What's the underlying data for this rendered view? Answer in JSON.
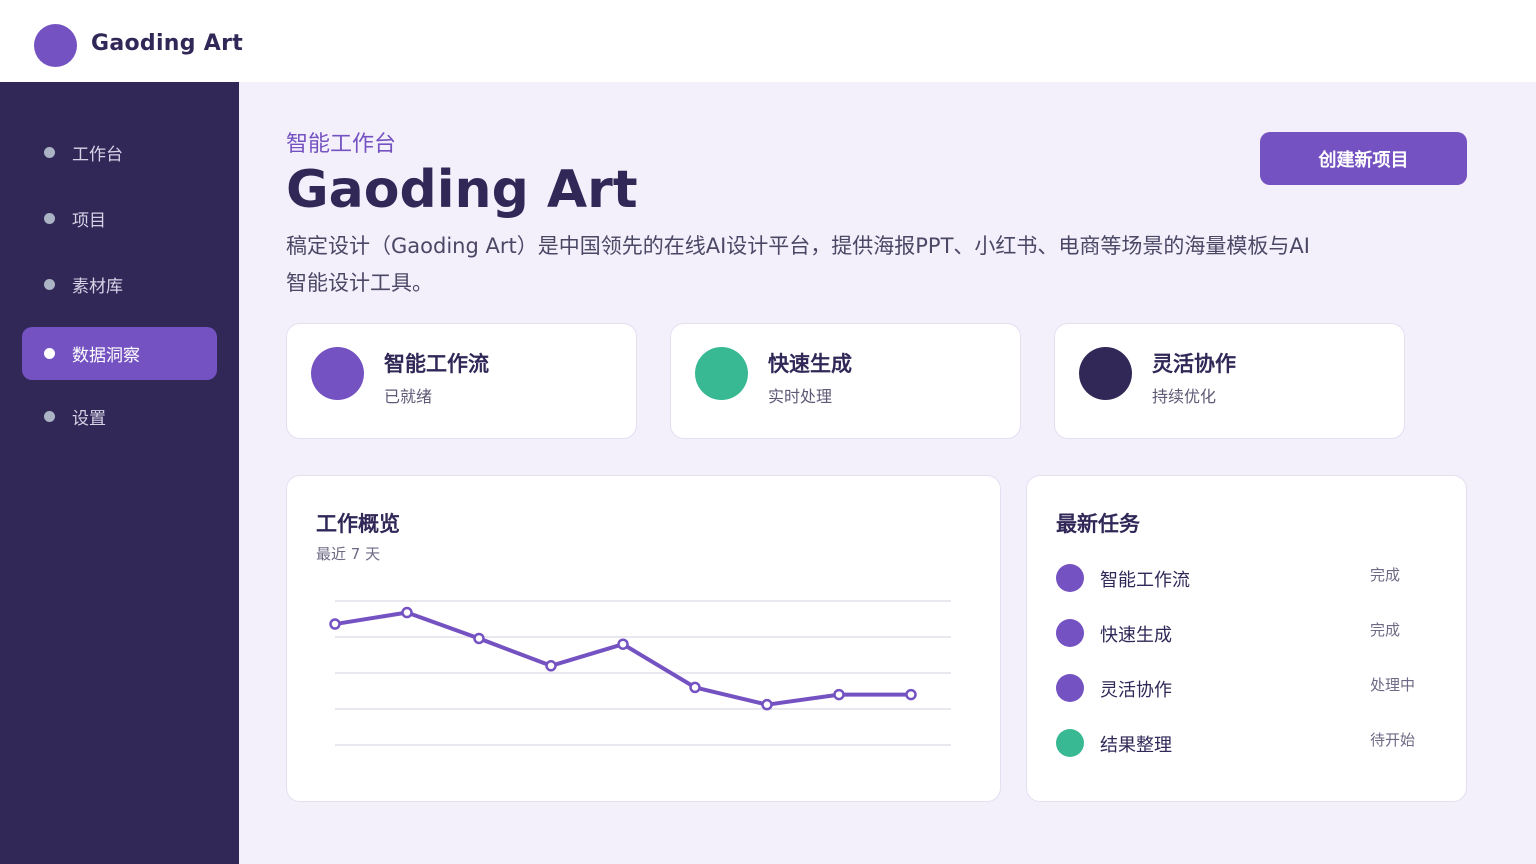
{
  "header": {
    "brand": "Gaoding Art"
  },
  "sidebar": {
    "items": [
      {
        "label": "工作台",
        "active": false
      },
      {
        "label": "项目",
        "active": false
      },
      {
        "label": "素材库",
        "active": false
      },
      {
        "label": "数据洞察",
        "active": true
      },
      {
        "label": "设置",
        "active": false
      }
    ]
  },
  "hero": {
    "eyebrow": "智能工作台",
    "title": "Gaoding Art",
    "description": "稿定设计（Gaoding Art）是中国领先的在线AI设计平台，提供海报PPT、小红书、电商等场景的海量模板与AI智能设计工具。",
    "cta_label": "创建新项目"
  },
  "stats": [
    {
      "title": "智能工作流",
      "subtitle": "已就绪",
      "color": "#7552c2"
    },
    {
      "title": "快速生成",
      "subtitle": "实时处理",
      "color": "#38b993"
    },
    {
      "title": "灵活协作",
      "subtitle": "持续优化",
      "color": "#312858"
    }
  ],
  "overview": {
    "title": "工作概览",
    "subtitle": "最近 7 天"
  },
  "chart_data": {
    "type": "line",
    "title": "工作概览",
    "subtitle": "最近 7 天",
    "xlabel": "",
    "ylabel": "",
    "ylim": [
      0,
      100
    ],
    "grid": true,
    "legend": "none",
    "series": [
      {
        "color": "#7552c2",
        "values": [
          84,
          92,
          74,
          55,
          70,
          40,
          28,
          35,
          35
        ]
      }
    ]
  },
  "tasks": {
    "title": "最新任务",
    "items": [
      {
        "label": "智能工作流",
        "status": "完成",
        "color": "#7552c2"
      },
      {
        "label": "快速生成",
        "status": "完成",
        "color": "#7552c2"
      },
      {
        "label": "灵活协作",
        "status": "处理中",
        "color": "#7552c2"
      },
      {
        "label": "结果整理",
        "status": "待开始",
        "color": "#38b993"
      }
    ]
  }
}
